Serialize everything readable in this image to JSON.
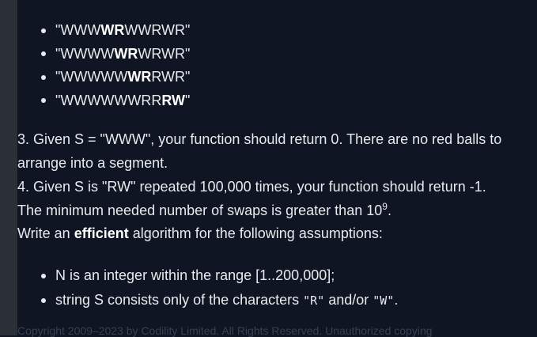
{
  "swap_examples": [
    {
      "pre": "\"WWW",
      "bold": "WR",
      "post": "WWRWR\""
    },
    {
      "pre": "\"WWWW",
      "bold": "WR",
      "post": "WRWR\""
    },
    {
      "pre": "\"WWWWW",
      "bold": "WR",
      "post": "RWR\""
    },
    {
      "pre": "\"WWWWWWRR",
      "bold": "RW",
      "post": "\""
    }
  ],
  "example3": {
    "line1": "3. Given S = \"WWW\", your function should return 0. There are no red balls to",
    "line2": "arrange into a segment."
  },
  "example4": {
    "line1": "4. Given S is \"RW\" repeated 100,000 times, your function should return -1.",
    "line2_pre": "The minimum needed number of swaps is greater than 10",
    "line2_sup": "9",
    "line2_post": "."
  },
  "instruction": {
    "pre": "Write an ",
    "bold": "efficient",
    "post": " algorithm for the following assumptions:"
  },
  "assumptions": {
    "item1": "N is an integer within the range [1..200,000];",
    "item2_pre": "string S consists only of the characters ",
    "item2_code1": "\"R\"",
    "item2_mid": " and/or ",
    "item2_code2": "\"W\"",
    "item2_post": "."
  },
  "footer_text": "Copyright 2009–2023 by Codility Limited. All Rights Reserved. Unauthorized copying"
}
